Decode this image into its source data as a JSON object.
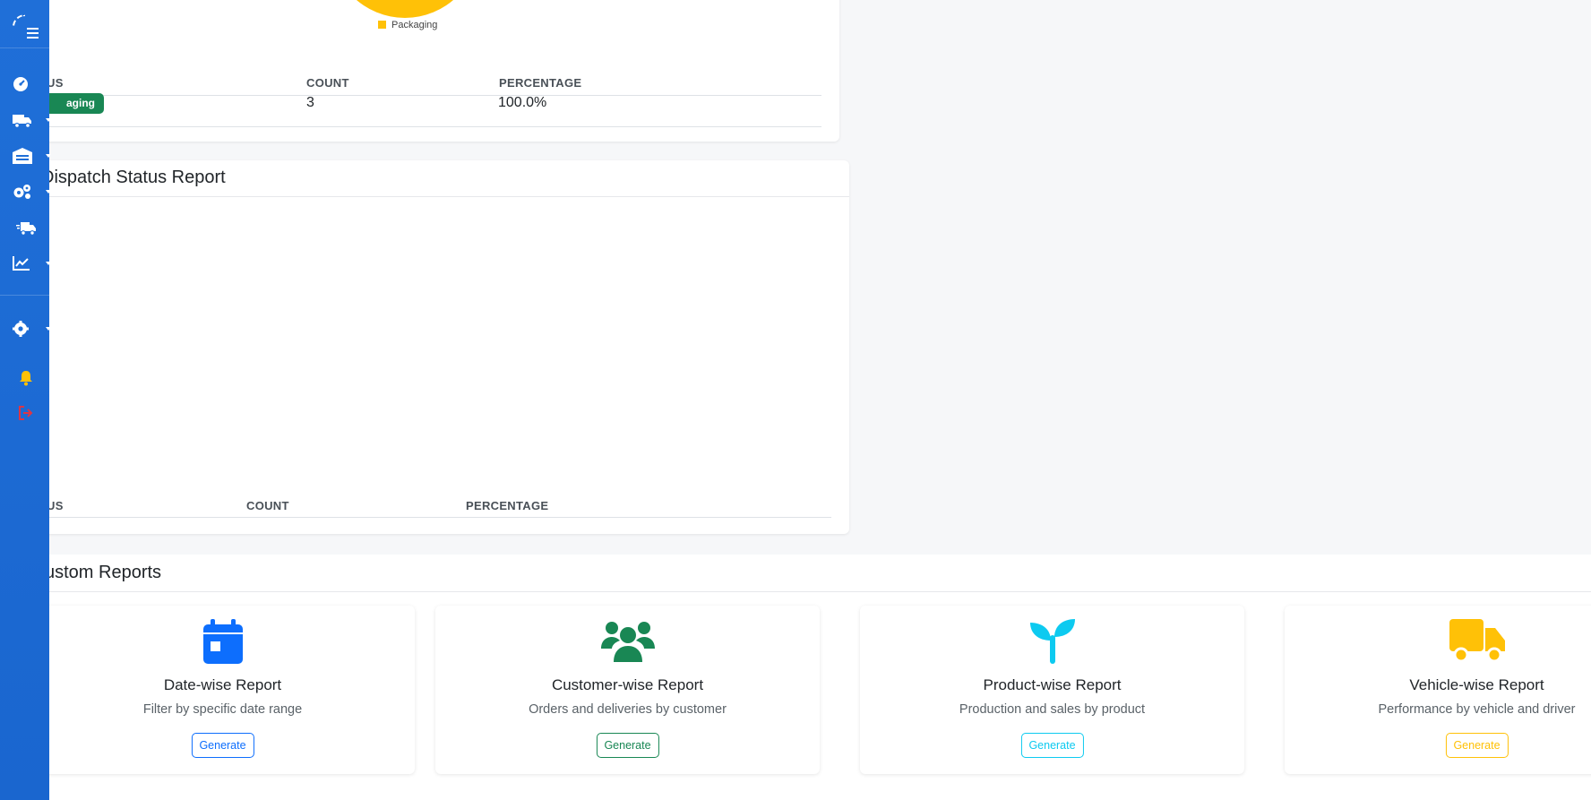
{
  "sidebar": {
    "icons": [
      "dashboard-icon",
      "truck-icon",
      "warehouse-icon",
      "cogs-icon",
      "delivery-truck-icon",
      "chart-line-icon",
      "settings-icon",
      "bell-icon",
      "logout-icon"
    ]
  },
  "status_card": {
    "legend_label": "Packaging",
    "legend_color": "#ffc107",
    "columns": [
      "US",
      "COUNT",
      "PERCENTAGE"
    ],
    "rows": [
      {
        "status": "aging",
        "count": "3",
        "percentage": "100.0%",
        "badge_color": "#198754"
      }
    ]
  },
  "dispatch_card": {
    "title": "Dispatch Status Report",
    "columns": [
      "US",
      "COUNT",
      "PERCENTAGE"
    ]
  },
  "custom_reports": {
    "title": "ustom Reports",
    "tiles": [
      {
        "title": "Date-wise Report",
        "desc": "Filter by specific date range",
        "button": "Generate",
        "color": "#0d6efd",
        "icon": "calendar-icon"
      },
      {
        "title": "Customer-wise Report",
        "desc": "Orders and deliveries by customer",
        "button": "Generate",
        "color": "#198754",
        "icon": "users-icon"
      },
      {
        "title": "Product-wise Report",
        "desc": "Production and sales by product",
        "button": "Generate",
        "color": "#0dcaf0",
        "icon": "seedling-icon"
      },
      {
        "title": "Vehicle-wise Report",
        "desc": "Performance by vehicle and driver",
        "button": "Generate",
        "color": "#ffc107",
        "icon": "truck-icon"
      }
    ]
  }
}
